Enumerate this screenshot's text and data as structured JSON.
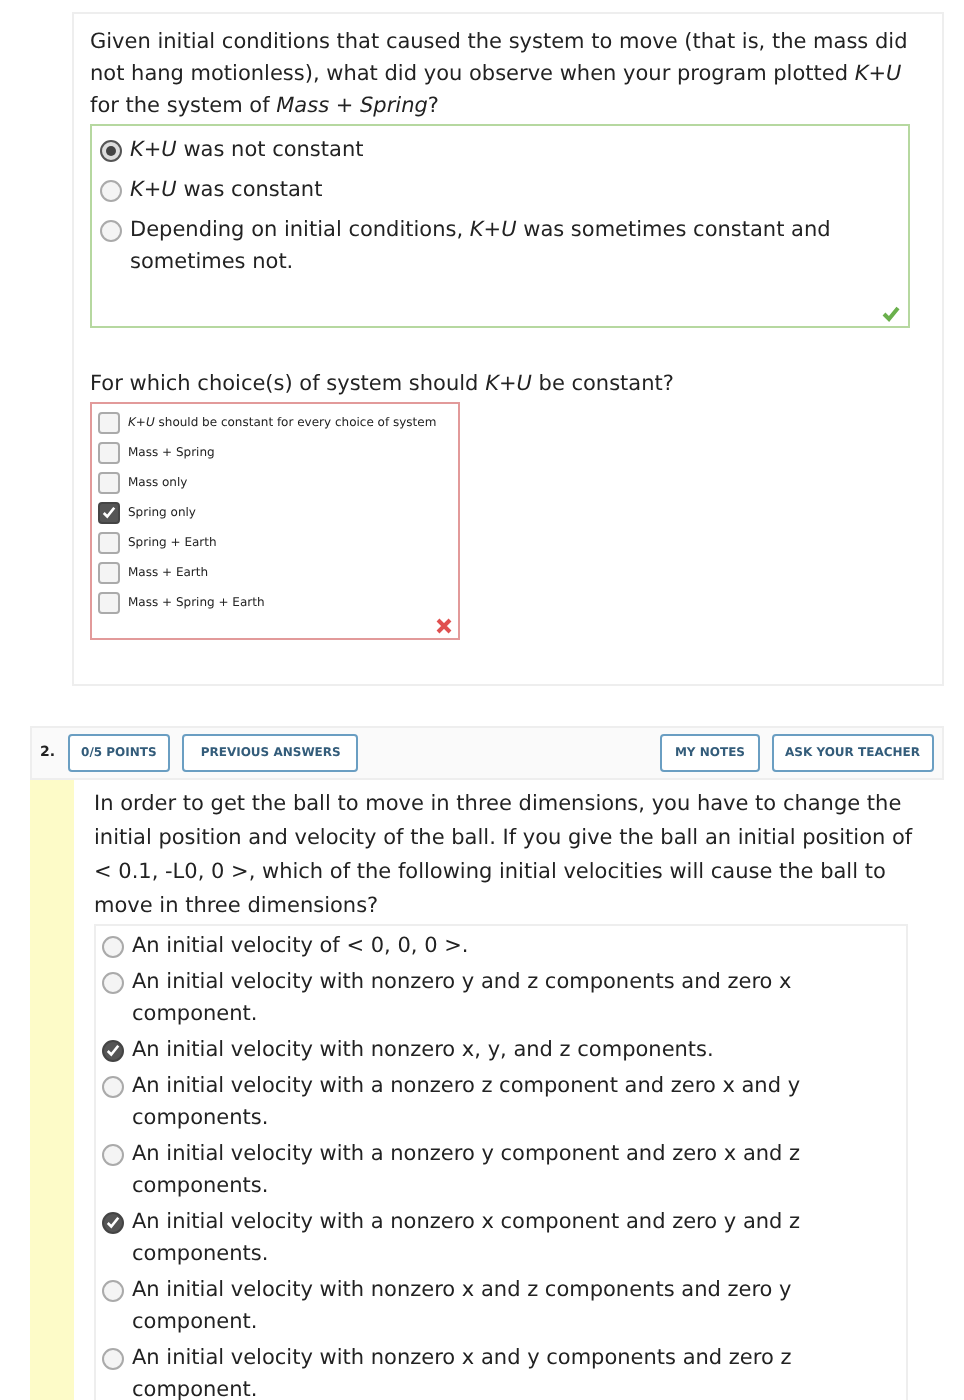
{
  "question_1": {
    "parts": [
      {
        "prompt": "Given initial conditions that caused the system to move (that is, the mass did not hang motionless), what did you observe when your program plotted *K+U* for the system of *Mass + Spring*?",
        "kind": "radio",
        "correct": true,
        "options": [
          {
            "label": "*K+U* was not constant",
            "selected": true
          },
          {
            "label": "*K+U* was constant",
            "selected": false
          },
          {
            "label": "Depending on initial conditions, *K+U* was sometimes constant and sometimes not.",
            "selected": false
          }
        ]
      },
      {
        "prompt": "For which choice(s) of system should *K+U* be constant?",
        "kind": "checkbox",
        "correct": false,
        "options": [
          {
            "label": "*K+U* should be constant for every choice of system",
            "checked": false
          },
          {
            "label": "Mass + Spring",
            "checked": false
          },
          {
            "label": "Mass only",
            "checked": false
          },
          {
            "label": "Spring only",
            "checked": true
          },
          {
            "label": "Spring + Earth",
            "checked": false
          },
          {
            "label": "Mass + Earth",
            "checked": false
          },
          {
            "label": "Mass + Spring + Earth",
            "checked": false
          }
        ]
      }
    ]
  },
  "question_2": {
    "number": "2.",
    "points": "0/5 POINTS",
    "previous_answers": "PREVIOUS ANSWERS",
    "my_notes": "MY NOTES",
    "ask_teacher": "ASK YOUR TEACHER",
    "prompt": "In order to get the ball to move in three dimensions, you have to change the initial position and velocity of the ball. If you give the ball an initial position of < 0.1, -L0, 0 >, which of the following initial velocities will cause the ball to move in three dimensions?",
    "options": [
      {
        "label": "An initial velocity of < 0, 0, 0 >.",
        "checked": false
      },
      {
        "label": "An initial velocity with nonzero y and z components and zero x component.",
        "checked": false
      },
      {
        "label": "An initial velocity with nonzero x, y, and z components.",
        "checked": true
      },
      {
        "label": "An initial velocity with a nonzero z component and zero x and y components.",
        "checked": false
      },
      {
        "label": "An initial velocity with a nonzero y component and zero x and z components.",
        "checked": false
      },
      {
        "label": "An initial velocity with a nonzero x component and zero y and z components.",
        "checked": true
      },
      {
        "label": "An initial velocity with nonzero x and z components and zero y component.",
        "checked": false
      },
      {
        "label": "An initial velocity with nonzero x and y components and zero z component.",
        "checked": false
      }
    ]
  }
}
